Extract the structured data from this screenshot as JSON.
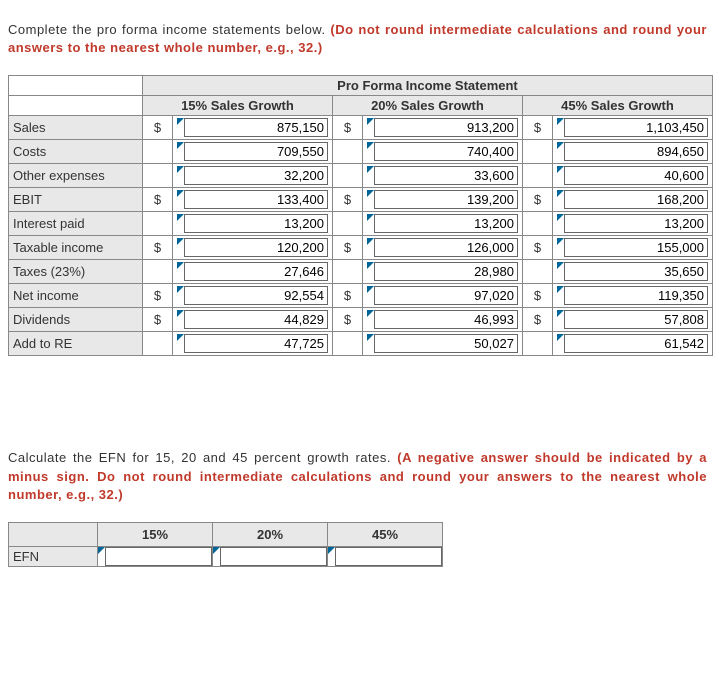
{
  "instructions": {
    "line1_a": "Complete the pro forma income statements below. ",
    "line1_b": "(Do not round intermediate calculations and round your answers to the nearest whole number, e.g., 32.)",
    "line2_a": "Calculate the EFN for 15, 20 and 45 percent growth rates. ",
    "line2_b": "(A negative answer should be indicated by a minus sign. Do not round intermediate calculations and round your answers to the nearest whole number, e.g., 32.)"
  },
  "main_table": {
    "title": "Pro Forma Income Statement",
    "columns": [
      "15% Sales Growth",
      "20% Sales Growth",
      "45% Sales Growth"
    ],
    "currency": "$",
    "rows": [
      {
        "label": "Sales",
        "dollar": true,
        "v": [
          "875,150",
          "913,200",
          "1,103,450"
        ]
      },
      {
        "label": "Costs",
        "dollar": false,
        "v": [
          "709,550",
          "740,400",
          "894,650"
        ]
      },
      {
        "label": "Other expenses",
        "dollar": false,
        "v": [
          "32,200",
          "33,600",
          "40,600"
        ]
      },
      {
        "label": "EBIT",
        "dollar": true,
        "v": [
          "133,400",
          "139,200",
          "168,200"
        ]
      },
      {
        "label": "Interest paid",
        "dollar": false,
        "v": [
          "13,200",
          "13,200",
          "13,200"
        ]
      },
      {
        "label": "Taxable income",
        "dollar": true,
        "v": [
          "120,200",
          "126,000",
          "155,000"
        ]
      },
      {
        "label": "Taxes (23%)",
        "dollar": false,
        "v": [
          "27,646",
          "28,980",
          "35,650"
        ]
      },
      {
        "label": "Net income",
        "dollar": true,
        "v": [
          "92,554",
          "97,020",
          "119,350"
        ]
      },
      {
        "label": "Dividends",
        "dollar": true,
        "v": [
          "44,829",
          "46,993",
          "57,808"
        ]
      },
      {
        "label": "Add to RE",
        "dollar": false,
        "v": [
          "47,725",
          "50,027",
          "61,542"
        ]
      }
    ]
  },
  "efn_table": {
    "columns": [
      "15%",
      "20%",
      "45%"
    ],
    "row_label": "EFN",
    "values": [
      "",
      "",
      ""
    ]
  }
}
